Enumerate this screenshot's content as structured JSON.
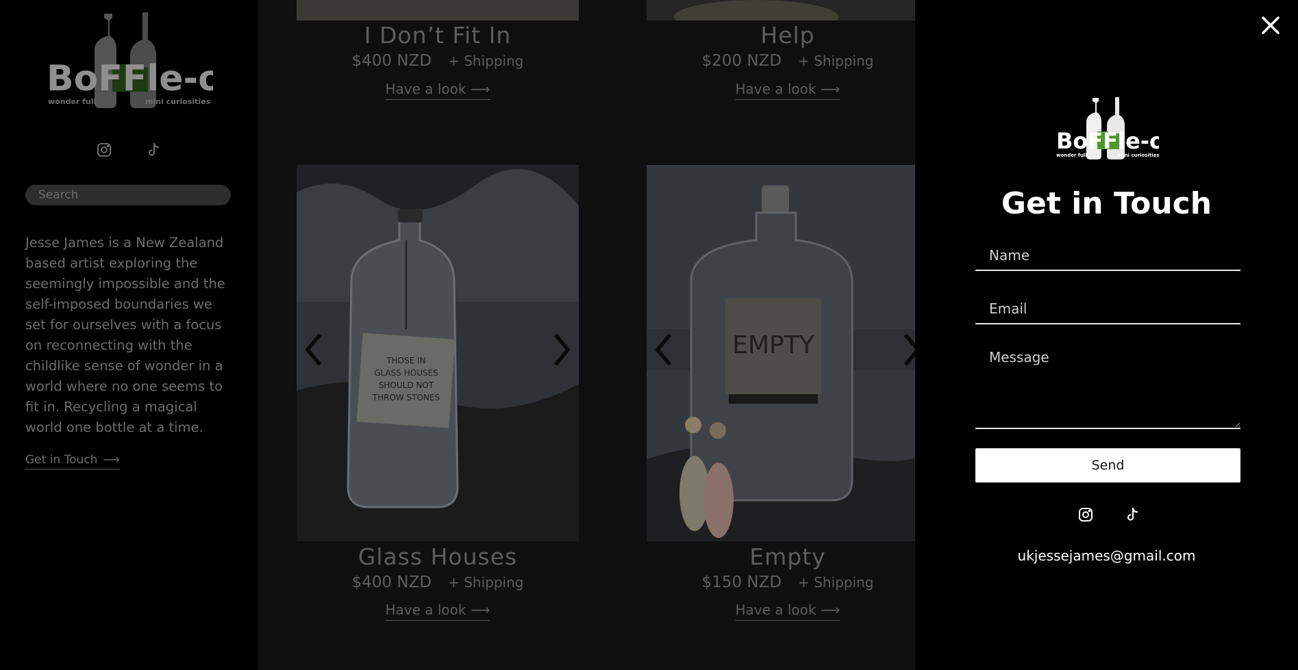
{
  "sidebar": {
    "logo_word": "BoFFle-oh",
    "logo_left": "wonder full",
    "logo_right": "mini curiosities",
    "search_placeholder": "Search",
    "bio": "Jesse James is a New Zealand based artist exploring the seemingly impossible and the self-imposed boundaries we set for ourselves with a focus on reconnecting with the childlike sense of wonder in a world where no one seems to fit in. Recycling a magical world one bottle at a time.",
    "cta_label": "Get in Touch",
    "cta_arrow": "⟶"
  },
  "products": [
    {
      "title": "I Don’t Fit In",
      "price": "$400 NZD",
      "shipping": "+ Shipping",
      "cta": "Have a look",
      "arrow": "⟶"
    },
    {
      "title": "Help",
      "price": "$200 NZD",
      "shipping": "+ Shipping",
      "cta": "Have a look",
      "arrow": "⟶"
    },
    {
      "title": "Glass Houses",
      "price": "$400 NZD",
      "shipping": "+ Shipping",
      "cta": "Have a look",
      "arrow": "⟶",
      "label_text": [
        "THOSE IN",
        "GLASS HOUSES",
        "SHOULD NOT",
        "THROW STONES"
      ]
    },
    {
      "title": "Empty",
      "price": "$150 NZD",
      "shipping": "+ Shipping",
      "cta": "Have a look",
      "arrow": "⟶",
      "label_text": [
        "EMPTY"
      ]
    }
  ],
  "contact": {
    "logo_word": "BoFFle-oh",
    "logo_left": "wonder full",
    "logo_right": "mini curiosities",
    "title": "Get in Touch",
    "name_placeholder": "Name",
    "email_placeholder": "Email",
    "message_placeholder": "Message",
    "send_label": "Send",
    "email": "ukjessejames@gmail.com"
  },
  "icons": {
    "instagram": "instagram-icon",
    "tiktok": "tiktok-icon",
    "close": "close-icon",
    "prev": "chevron-left-icon",
    "next": "chevron-right-icon"
  },
  "colors": {
    "brand_green": "#4c9a2a",
    "panel_bg": "#000000",
    "overlay_text": "#5d5d5d"
  }
}
